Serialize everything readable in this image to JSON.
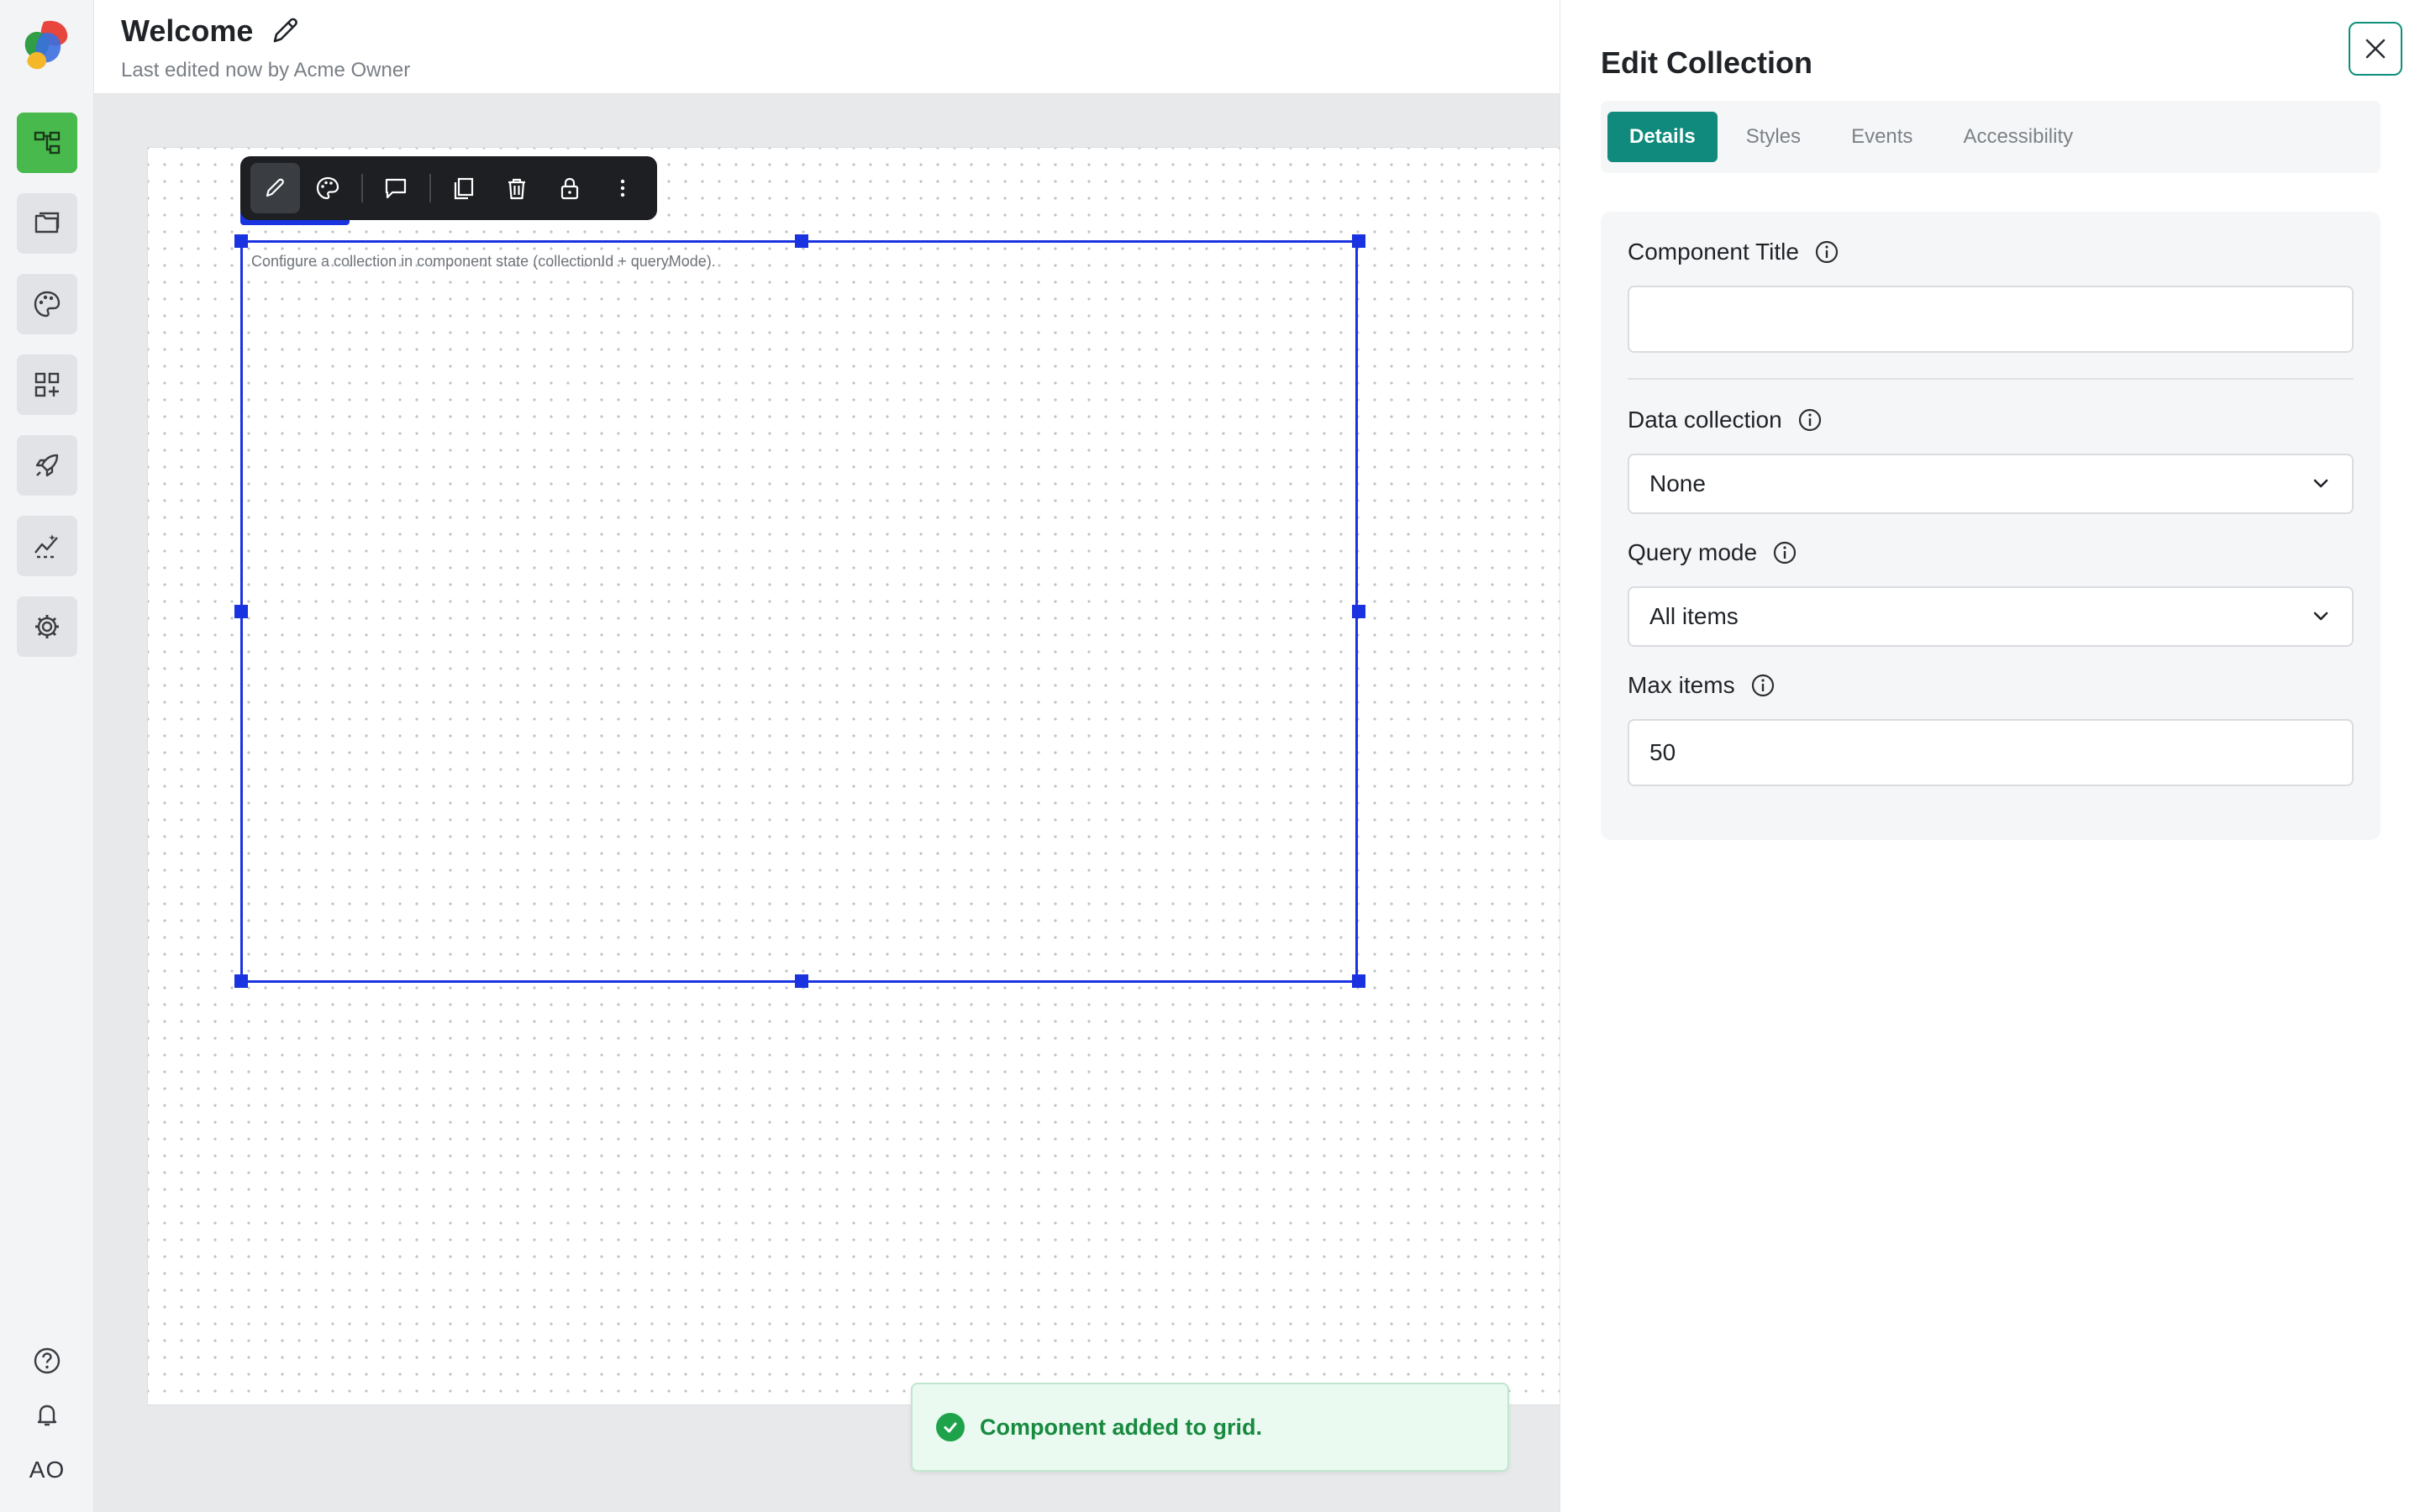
{
  "header": {
    "title": "Welcome",
    "subtitle": "Last edited now by Acme Owner"
  },
  "rail": {
    "items": [
      {
        "icon": "hierarchy-icon",
        "active": true
      },
      {
        "icon": "pages-icon",
        "active": false
      },
      {
        "icon": "palette-icon",
        "active": false
      },
      {
        "icon": "add-component-icon",
        "active": false
      },
      {
        "icon": "rocket-icon",
        "active": false
      },
      {
        "icon": "analytics-icon",
        "active": false
      },
      {
        "icon": "settings-icon",
        "active": false
      }
    ],
    "bottom": {
      "help_icon": "help-icon",
      "bell_icon": "bell-icon",
      "avatar_initials": "AO"
    },
    "accent_color": "#48b94c"
  },
  "toolbar": {
    "buttons": [
      "edit-icon",
      "palette-icon",
      "comment-icon",
      "duplicate-icon",
      "delete-icon",
      "lock-icon",
      "more-icon"
    ]
  },
  "canvas": {
    "placeholder": "Configure a collection in component state (collectionId + queryMode).",
    "selection_color": "#1a33e0"
  },
  "toast": {
    "message": "Component added to grid.",
    "color": "#1ea34a"
  },
  "panel": {
    "title": "Edit Collection",
    "tabs": [
      {
        "label": "Details",
        "active": true
      },
      {
        "label": "Styles",
        "active": false
      },
      {
        "label": "Events",
        "active": false
      },
      {
        "label": "Accessibility",
        "active": false
      }
    ],
    "tab_active_color": "#0f8a7c",
    "fields": {
      "component_title": {
        "label": "Component Title",
        "value": ""
      },
      "data_collection": {
        "label": "Data collection",
        "value": "None"
      },
      "query_mode": {
        "label": "Query mode",
        "value": "All items"
      },
      "max_items": {
        "label": "Max items",
        "value": "50"
      }
    }
  }
}
